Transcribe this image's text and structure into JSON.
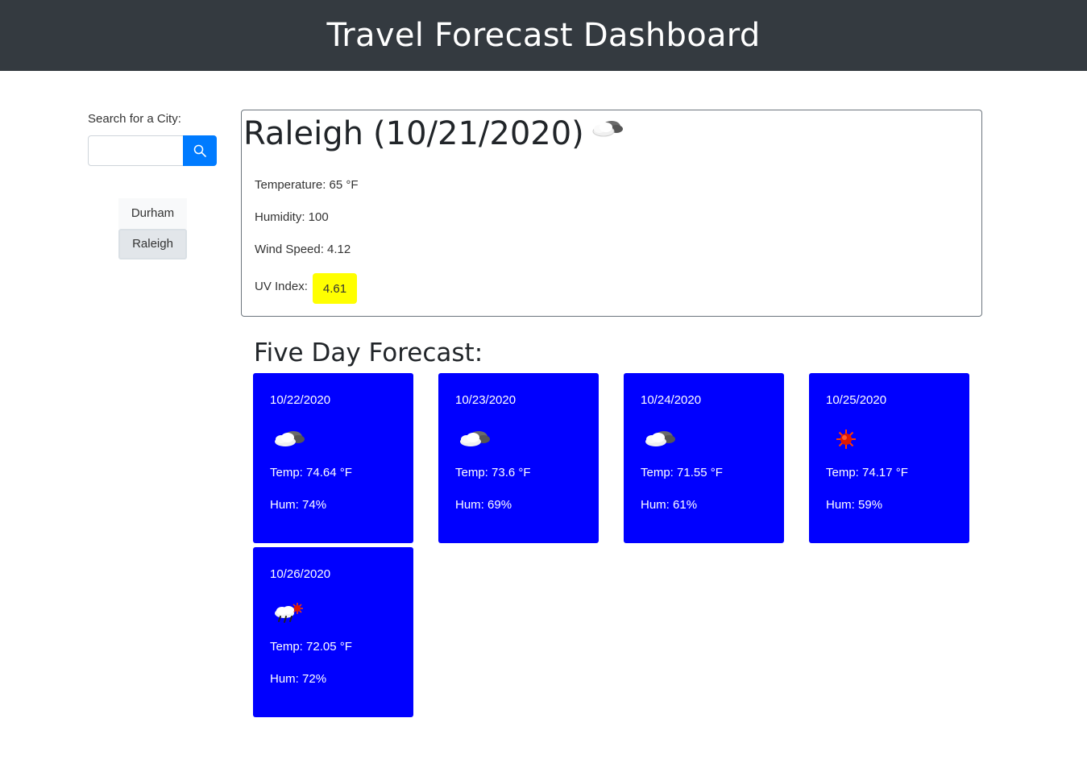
{
  "header": {
    "title": "Travel Forecast Dashboard"
  },
  "search": {
    "label": "Search for a City:",
    "value": "",
    "button_icon": "search-icon"
  },
  "history": [
    {
      "label": "Durham",
      "active": false
    },
    {
      "label": "Raleigh",
      "active": true
    }
  ],
  "current": {
    "city": "Raleigh",
    "date": "(10/21/2020)",
    "icon": "cloudy-icon",
    "temperature": "Temperature: 65 °F",
    "humidity": "Humidity: 100",
    "wind": "Wind Speed: 4.12",
    "uv_label": "UV Index:",
    "uv_value": "4.61",
    "uv_color": "#ffff00"
  },
  "forecast": {
    "title": "Five Day Forecast:",
    "card_color": "#0000ff",
    "days": [
      {
        "date": "10/22/2020",
        "icon": "cloudy-icon",
        "temp": "Temp: 74.64 °F",
        "hum": "Hum: 74%"
      },
      {
        "date": "10/23/2020",
        "icon": "cloudy-icon",
        "temp": "Temp: 73.6 °F",
        "hum": "Hum: 69%"
      },
      {
        "date": "10/24/2020",
        "icon": "cloudy-icon",
        "temp": "Temp: 71.55 °F",
        "hum": "Hum: 61%"
      },
      {
        "date": "10/25/2020",
        "icon": "sun-icon",
        "temp": "Temp: 74.17 °F",
        "hum": "Hum: 59%"
      },
      {
        "date": "10/26/2020",
        "icon": "rain-sun-icon",
        "temp": "Temp: 72.05 °F",
        "hum": "Hum: 72%"
      }
    ]
  }
}
